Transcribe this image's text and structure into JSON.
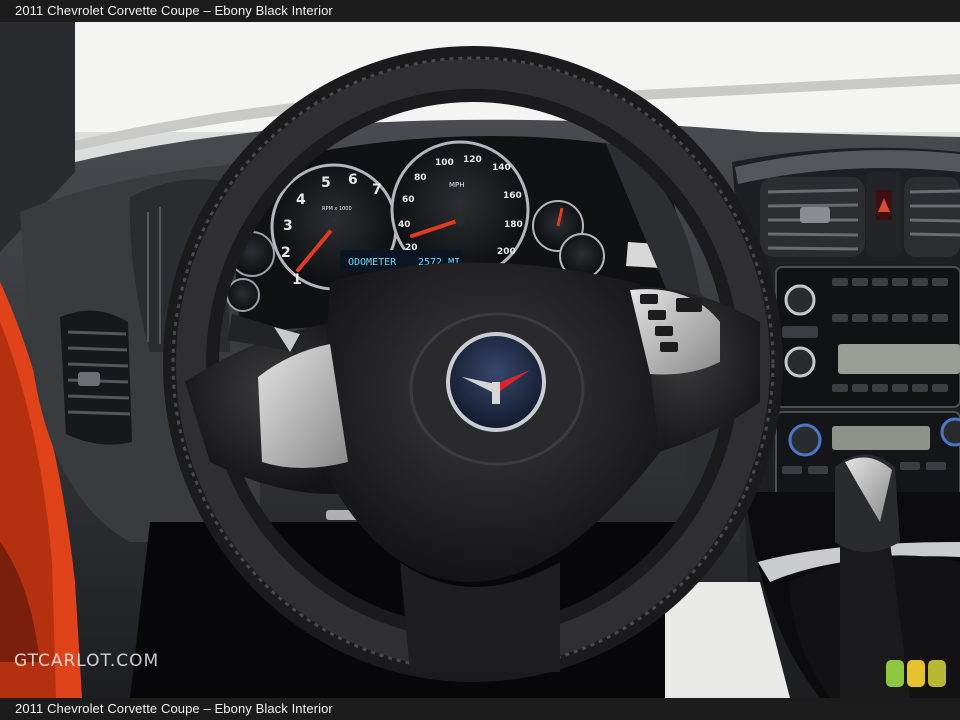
{
  "caption": {
    "top": "2011 Chevrolet Corvette Coupe – Ebony Black Interior",
    "bottom": "2011 Chevrolet Corvette Coupe – Ebony Black Interior"
  },
  "watermark": "GTCARLOT.COM",
  "cluster": {
    "tach_label": "RPM x 1000",
    "tach_ticks": [
      "1",
      "2",
      "3",
      "4",
      "5",
      "6",
      "7"
    ],
    "speedo_label": "MPH",
    "speedo_ticks": [
      "20",
      "40",
      "60",
      "80",
      "100",
      "120",
      "140",
      "160",
      "180",
      "200"
    ],
    "odometer_label": "ODOMETER",
    "odometer_value": "2572 MI"
  },
  "colors": {
    "exterior": "#e0421a",
    "badge_green": "#8ec63f",
    "badge_yellow": "#e6c12e",
    "badge_olive": "#b9b832"
  }
}
